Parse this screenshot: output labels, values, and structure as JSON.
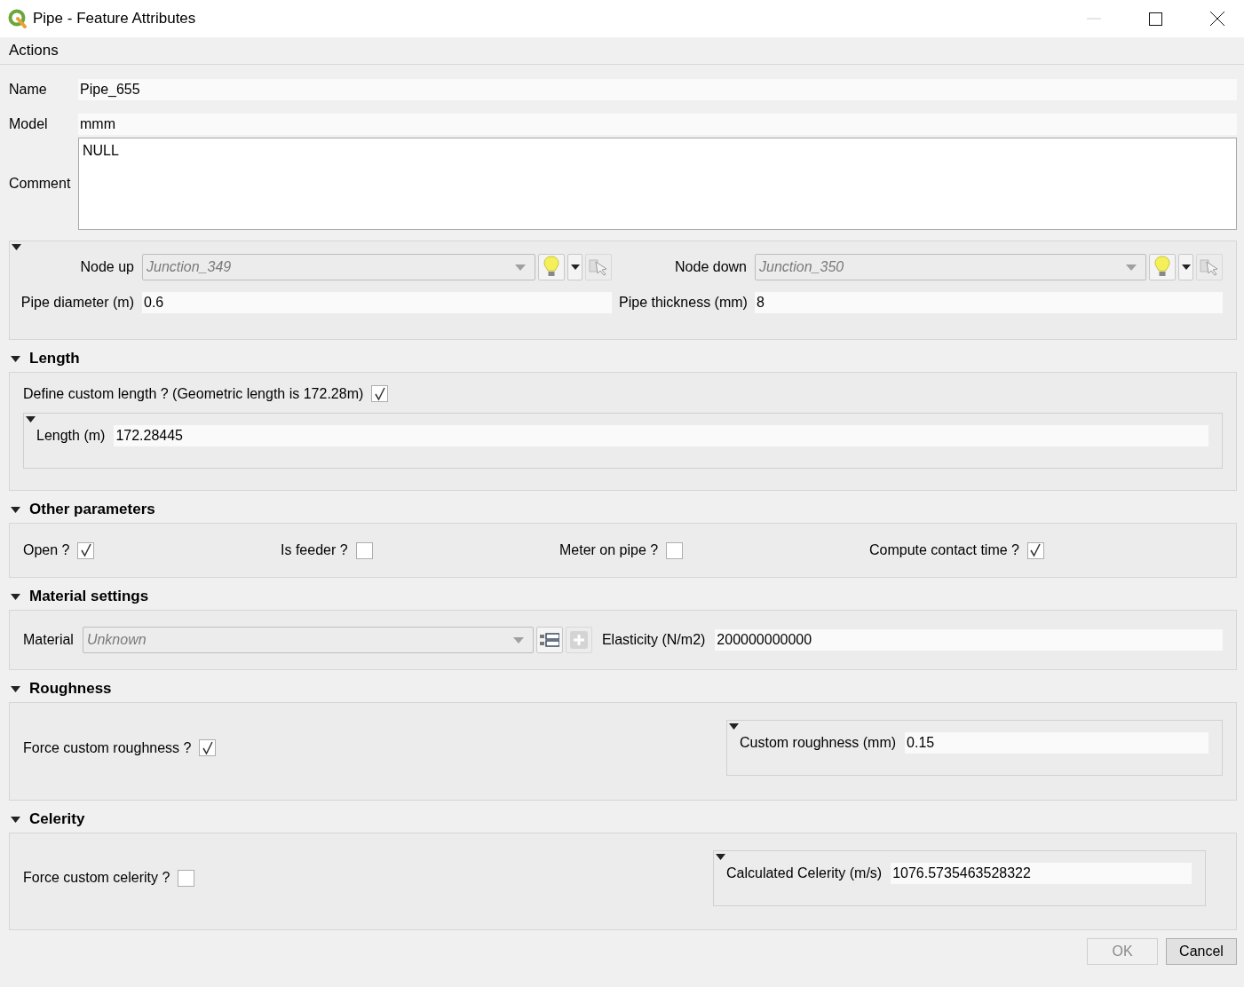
{
  "window": {
    "title": "Pipe - Feature Attributes"
  },
  "menu": [
    {
      "label": "Actions"
    }
  ],
  "fields": [
    {
      "label": "Name",
      "value": "Pipe_655",
      "kind": "line"
    },
    {
      "label": "Model",
      "value": "mmm",
      "kind": "line"
    },
    {
      "label": "Comment",
      "value": "NULL",
      "kind": "multiline"
    }
  ],
  "nodes": {
    "expanded": true,
    "relations": [
      {
        "label": "Node up",
        "value": "Junction_349"
      },
      {
        "label": "Node down",
        "value": "Junction_350"
      }
    ],
    "fields": [
      {
        "label": "Pipe diameter (m)",
        "value": "0.6"
      },
      {
        "label": "Pipe thickness (mm)",
        "value": "8"
      }
    ]
  },
  "length": {
    "title": "Length",
    "expanded": true,
    "checkbox": {
      "label": "Define custom length ? (Geometric length is 172.28m)",
      "checked": true
    },
    "sub": {
      "expanded": true,
      "label": "Length (m)",
      "value": "172.28445"
    }
  },
  "other": {
    "title": "Other parameters",
    "expanded": true,
    "checkboxes": [
      {
        "label": "Open ?",
        "checked": true
      },
      {
        "label": "Is feeder ?",
        "checked": false
      },
      {
        "label": "Meter on pipe ?",
        "checked": false
      },
      {
        "label": "Compute contact time ?",
        "checked": true
      }
    ]
  },
  "material": {
    "title": "Material settings",
    "expanded": true,
    "combo": {
      "label": "Material",
      "value": "Unknown"
    },
    "elasticity": {
      "label": "Elasticity (N/m2)",
      "value": "200000000000"
    }
  },
  "roughness": {
    "title": "Roughness",
    "expanded": true,
    "checkbox": {
      "label": "Force custom roughness ?",
      "checked": true
    },
    "sub": {
      "expanded": true,
      "label": "Custom roughness (mm)",
      "value": "0.15"
    }
  },
  "celerity": {
    "title": "Celerity",
    "expanded": true,
    "checkbox": {
      "label": "Force custom celerity ?",
      "checked": false
    },
    "sub": {
      "expanded": true,
      "label": "Calculated Celerity (m/s)",
      "value": "1076.5735463528322"
    }
  },
  "buttons": [
    {
      "label": "OK",
      "disabled": true
    },
    {
      "label": "Cancel",
      "disabled": false
    }
  ]
}
